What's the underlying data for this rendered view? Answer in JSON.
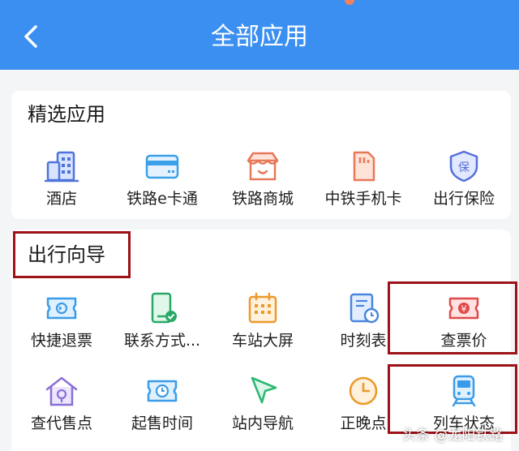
{
  "header": {
    "title": "全部应用",
    "back_icon": "chevron-left-icon",
    "color": "#3b8ff0"
  },
  "featured": {
    "title": "精选应用",
    "items": [
      {
        "label": "酒店",
        "icon": "building-icon"
      },
      {
        "label": "铁路e卡通",
        "icon": "card-icon"
      },
      {
        "label": "铁路商城",
        "icon": "shop-icon"
      },
      {
        "label": "中铁手机卡",
        "icon": "sim-card-icon"
      },
      {
        "label": "出行保险",
        "icon": "shield-insurance-icon"
      }
    ]
  },
  "travel_guide": {
    "title": "出行向导",
    "items": [
      {
        "label": "快捷退票",
        "icon": "ticket-refund-icon"
      },
      {
        "label": "联系方式...",
        "icon": "phone-check-icon"
      },
      {
        "label": "车站大屏",
        "icon": "calendar-screen-icon"
      },
      {
        "label": "时刻表",
        "icon": "timetable-icon"
      },
      {
        "label": "查票价",
        "icon": "ticket-price-icon"
      },
      {
        "label": "查代售点",
        "icon": "agency-house-icon"
      },
      {
        "label": "起售时间",
        "icon": "ticket-clock-icon"
      },
      {
        "label": "站内导航",
        "icon": "navigation-arrow-icon"
      },
      {
        "label": "正晚点",
        "icon": "clock-icon"
      },
      {
        "label": "列车状态",
        "icon": "train-icon"
      }
    ]
  },
  "watermark": "头条 @龙阳铁路",
  "highlight_color": "#9c1218"
}
